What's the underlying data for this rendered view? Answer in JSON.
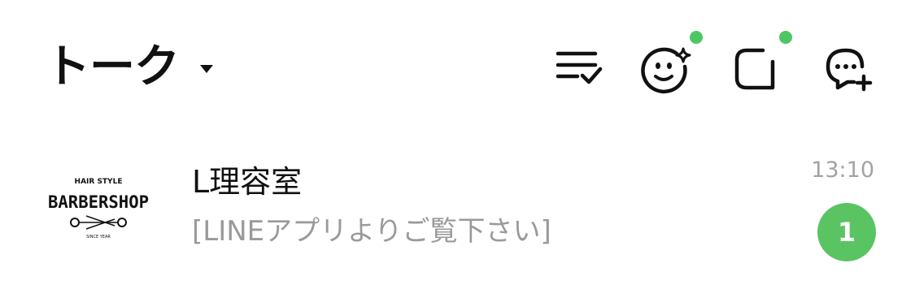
{
  "header": {
    "title": "トーク",
    "icons": [
      "filter-check-icon",
      "face-sparkle-icon",
      "square-notch-icon",
      "chat-plus-icon"
    ],
    "notification_color": "#4cc764"
  },
  "chats": [
    {
      "name": "L理容室",
      "preview": "[LINEアプリよりご覧下さい]",
      "time": "13:10",
      "unread": "1",
      "avatar": {
        "top_text": "HAIR STYLE",
        "main_text": "BARBERSHOP",
        "bottom_text": "SINCE YEAR"
      }
    }
  ],
  "colors": {
    "accent_green": "#5ac463",
    "text_primary": "#111111",
    "text_secondary": "#9a9a9a"
  }
}
